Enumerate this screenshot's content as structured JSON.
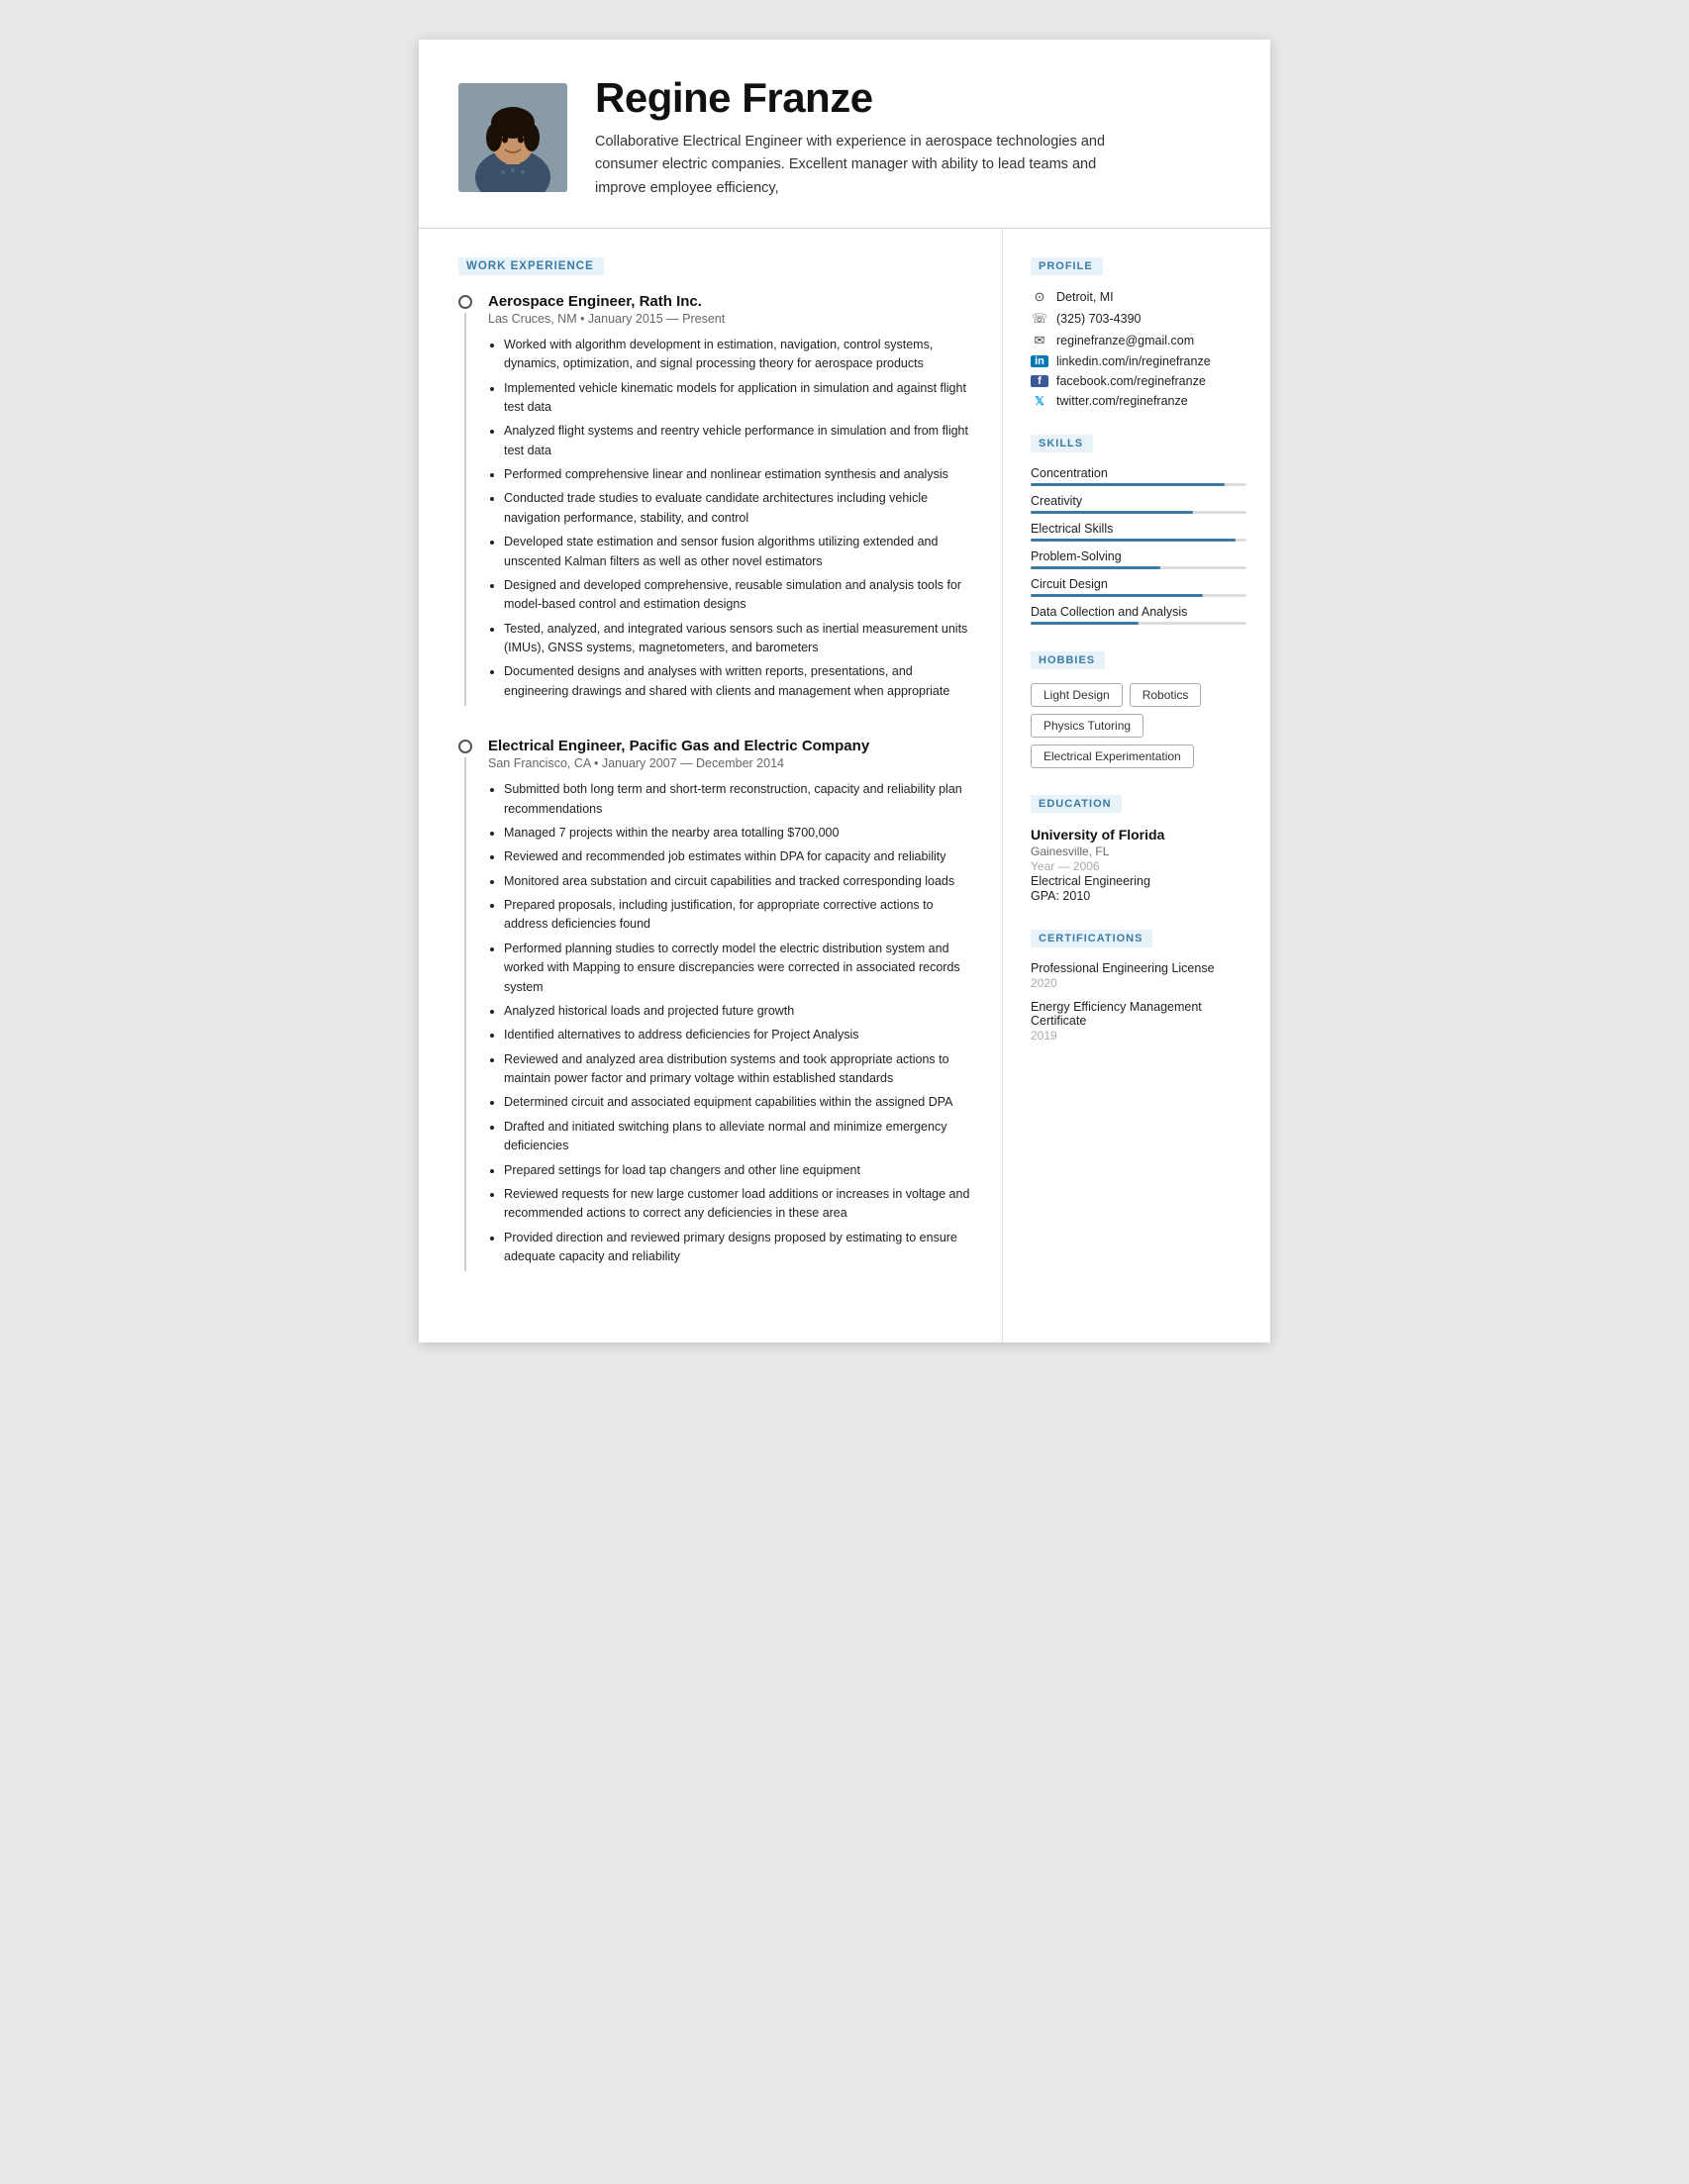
{
  "header": {
    "name": "Regine Franze",
    "tagline": "Collaborative Electrical Engineer with experience in aerospace technologies and consumer electric companies. Excellent manager with ability to lead teams and improve employee efficiency,",
    "avatar_alt": "Regine Franze photo"
  },
  "left": {
    "work_experience_label": "WORK EXPERIENCE",
    "jobs": [
      {
        "title": "Aerospace Engineer, Rath Inc.",
        "meta": "Las Cruces, NM • January 2015 — Present",
        "bullets": [
          "Worked with algorithm development in estimation, navigation, control systems, dynamics, optimization, and signal processing theory for aerospace products",
          "Implemented vehicle kinematic models for application in simulation and against flight test data",
          "Analyzed flight systems and reentry vehicle performance in simulation and from flight test data",
          "Performed comprehensive linear and nonlinear estimation synthesis and analysis",
          "Conducted trade studies to evaluate candidate architectures including vehicle navigation performance, stability, and control",
          "Developed state estimation and sensor fusion algorithms utilizing extended and unscented Kalman filters as well as other novel estimators",
          "Designed and developed comprehensive, reusable simulation and analysis tools for model-based control and estimation designs",
          "Tested, analyzed, and integrated various sensors such as inertial measurement units (IMUs), GNSS systems, magnetometers, and barometers",
          "Documented designs and analyses with written reports, presentations, and engineering drawings and shared with clients and management when appropriate"
        ]
      },
      {
        "title": "Electrical Engineer, Pacific Gas and Electric Company",
        "meta": "San Francisco, CA • January 2007 — December 2014",
        "bullets": [
          "Submitted both long term and short-term reconstruction, capacity and reliability plan recommendations",
          "Managed 7 projects within the nearby area totalling $700,000",
          "Reviewed and recommended job estimates within DPA for capacity and reliability",
          "Monitored area substation and circuit capabilities and tracked corresponding loads",
          "Prepared proposals, including justification, for appropriate corrective actions to address deficiencies found",
          "Performed planning studies to correctly model the electric distribution system and worked with Mapping to ensure discrepancies were corrected in associated records system",
          "Analyzed historical loads and projected future growth",
          "Identified alternatives to address deficiencies for Project Analysis",
          "Reviewed and analyzed area distribution systems and took appropriate actions to maintain power factor and primary voltage within established standards",
          "Determined circuit and associated equipment capabilities within the assigned DPA",
          "Drafted and initiated switching plans to alleviate normal and minimize emergency deficiencies",
          "Prepared settings for load tap changers and other line equipment",
          "Reviewed requests for new large customer load additions or increases in voltage and recommended actions to correct any deficiencies in these area",
          "Provided direction and reviewed primary designs proposed by estimating to ensure adequate capacity and reliability"
        ]
      }
    ]
  },
  "right": {
    "profile_label": "PROFILE",
    "profile": {
      "location": "Detroit, MI",
      "phone": "(325) 703-4390",
      "email": "reginefranze@gmail.com",
      "linkedin": "linkedin.com/in/reginefranze",
      "facebook": "facebook.com/reginefranze",
      "twitter": "twitter.com/reginefranze"
    },
    "skills_label": "SKILLS",
    "skills": [
      {
        "name": "Concentration",
        "level": 90
      },
      {
        "name": "Creativity",
        "level": 75
      },
      {
        "name": "Electrical Skills",
        "level": 95
      },
      {
        "name": "Problem-Solving",
        "level": 60
      },
      {
        "name": "Circuit Design",
        "level": 80
      },
      {
        "name": "Data Collection and Analysis",
        "level": 50
      }
    ],
    "hobbies_label": "HOBBIES",
    "hobbies": [
      "Light Design",
      "Robotics",
      "Physics Tutoring",
      "Electrical Experimentation"
    ],
    "education_label": "EDUCATION",
    "education": [
      {
        "uni": "University of Florida",
        "location": "Gainesville, FL",
        "year": "Year — 2006",
        "field": "Electrical Engineering",
        "gpa": "GPA: 2010"
      }
    ],
    "certifications_label": "CERTIFICATIONS",
    "certifications": [
      {
        "name": "Professional Engineering License",
        "year": "2020"
      },
      {
        "name": "Energy Efficiency Management Certificate",
        "year": "2019"
      }
    ]
  }
}
